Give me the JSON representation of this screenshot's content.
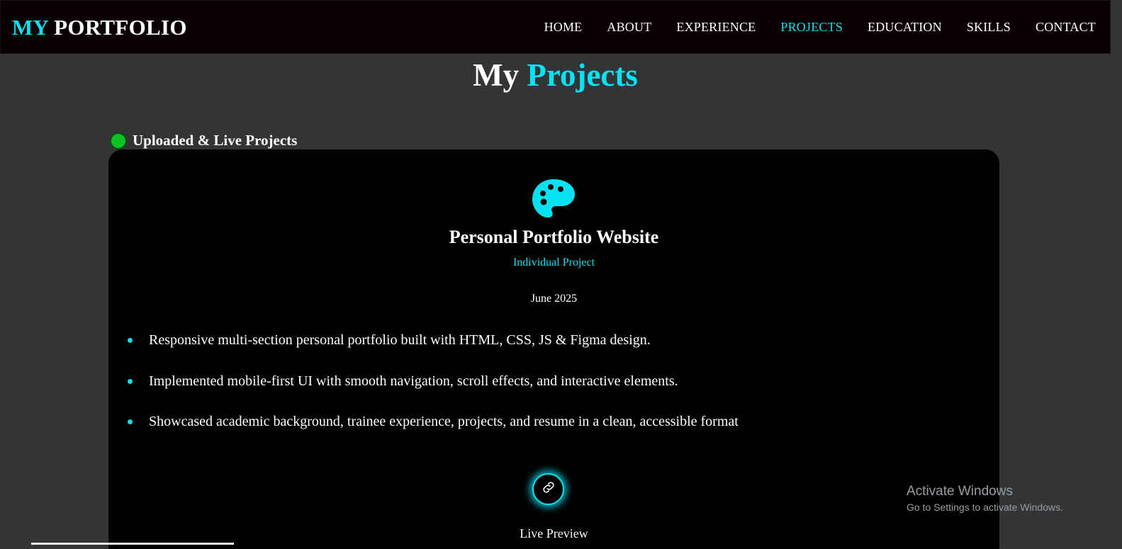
{
  "brand": {
    "accent": "MY",
    "rest": "PORTFOLIO"
  },
  "nav": {
    "items": [
      {
        "label": "HOME"
      },
      {
        "label": "ABOUT"
      },
      {
        "label": "EXPERIENCE"
      },
      {
        "label": "PROJECTS",
        "active": true
      },
      {
        "label": "EDUCATION"
      },
      {
        "label": "SKILLS"
      },
      {
        "label": "CONTACT"
      }
    ]
  },
  "section": {
    "title_plain": "My",
    "title_accent": "Projects"
  },
  "subheading": {
    "label": "Uploaded & Live Projects",
    "status_icon": "green-dot-icon"
  },
  "project": {
    "icon": "palette-icon",
    "title": "Personal Portfolio Website",
    "type": "Individual Project",
    "date": "June 2025",
    "bullets": [
      "Responsive multi-section personal portfolio built with HTML, CSS, JS & Figma design.",
      "Implemented mobile-first UI with smooth navigation, scroll effects, and interactive elements.",
      "Showcased academic background, trainee experience, projects, and resume in a clean, accessible format"
    ],
    "link_icon": "link-icon",
    "live_preview_label": "Live Preview"
  },
  "watermark": {
    "line1": "Activate Windows",
    "line2": "Go to Settings to activate Windows."
  },
  "colors": {
    "accent": "#05e2f3",
    "background": "#323436",
    "navbar": "#0b0001",
    "card": "#000000",
    "live_status": "#10c123"
  }
}
